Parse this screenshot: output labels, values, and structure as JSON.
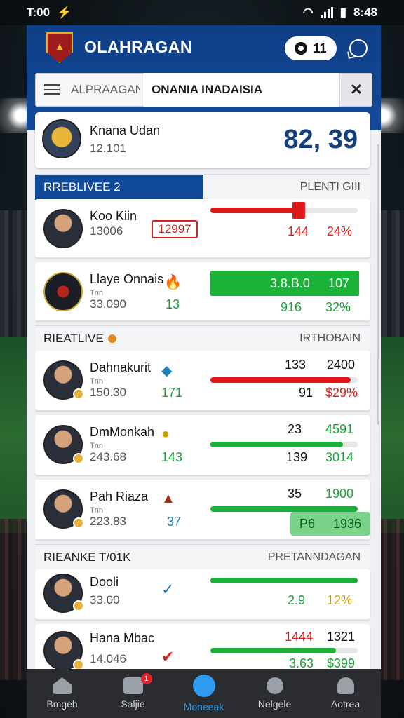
{
  "status_bar": {
    "time": "T:00",
    "battery_time": "8:48"
  },
  "app": {
    "title": "OLAHRAGAN",
    "logo_text": "",
    "pill_value": "11"
  },
  "search": {
    "left_text": "ALPRAAGAN",
    "tab_text": "ONANIA INADAISIA"
  },
  "top_card": {
    "name": "Knana Udan",
    "sub": "12.101",
    "score": "82, 39"
  },
  "sections": [
    {
      "left": "RREBLIVEE 2",
      "right": "PLENTI GIII",
      "rows": [
        {
          "name": "Koo Kiin",
          "sub": "13006",
          "box_value": "12997",
          "n1": "144",
          "n2": "24%"
        },
        {
          "name": "Llaye Onnais",
          "small": "Tnn",
          "sub": "33.090",
          "mid": "13",
          "banner_a": "3.8.B.0",
          "banner_b": "107",
          "n1": "916",
          "n2": "32%"
        }
      ]
    },
    {
      "left": "RIEATLIVE",
      "right": "IRTHOBAIN",
      "rows": [
        {
          "name": "Dahnakurit",
          "small": "Tnn",
          "sub": "150.30",
          "mid": "171",
          "n1": "133",
          "n2": "2400",
          "n3": "91",
          "n4": "$29%"
        },
        {
          "name": "DmMonkah",
          "small": "Tnn",
          "sub": "243.68",
          "mid": "143",
          "n1": "23",
          "n2": "4591",
          "n3": "139",
          "n4": "3014"
        },
        {
          "name": "Pah Riaza",
          "small": "Tnn",
          "sub": "223.83",
          "mid": "37",
          "n1": "35",
          "n2": "1900",
          "n3": "P6",
          "n4": "1936"
        }
      ]
    },
    {
      "left": "RIEANKE T/01K",
      "right": "PRETANNDAGAN",
      "rows": [
        {
          "name": "Dooli",
          "sub": "33.00",
          "n1": "2.9",
          "n2": "12%"
        },
        {
          "name": "Hana Mbac",
          "sub": "14.046",
          "n1": "1444",
          "n2": "1321",
          "n3": "3.63",
          "n4": "$399"
        }
      ]
    }
  ],
  "nav": [
    {
      "label": "Bmgeh"
    },
    {
      "label": "Saljie",
      "badge": "1"
    },
    {
      "label": "Moneeak"
    },
    {
      "label": "Nelgele"
    },
    {
      "label": "Aotrea"
    }
  ],
  "progress": {
    "r1": 0.6,
    "r3": 0.95,
    "r4": 0.9,
    "r5": 1.0,
    "r6": 1.0,
    "r7": 0.85
  },
  "colors": {
    "brand_blue": "#124a9a",
    "green": "#1fae3a",
    "red": "#e01818"
  }
}
